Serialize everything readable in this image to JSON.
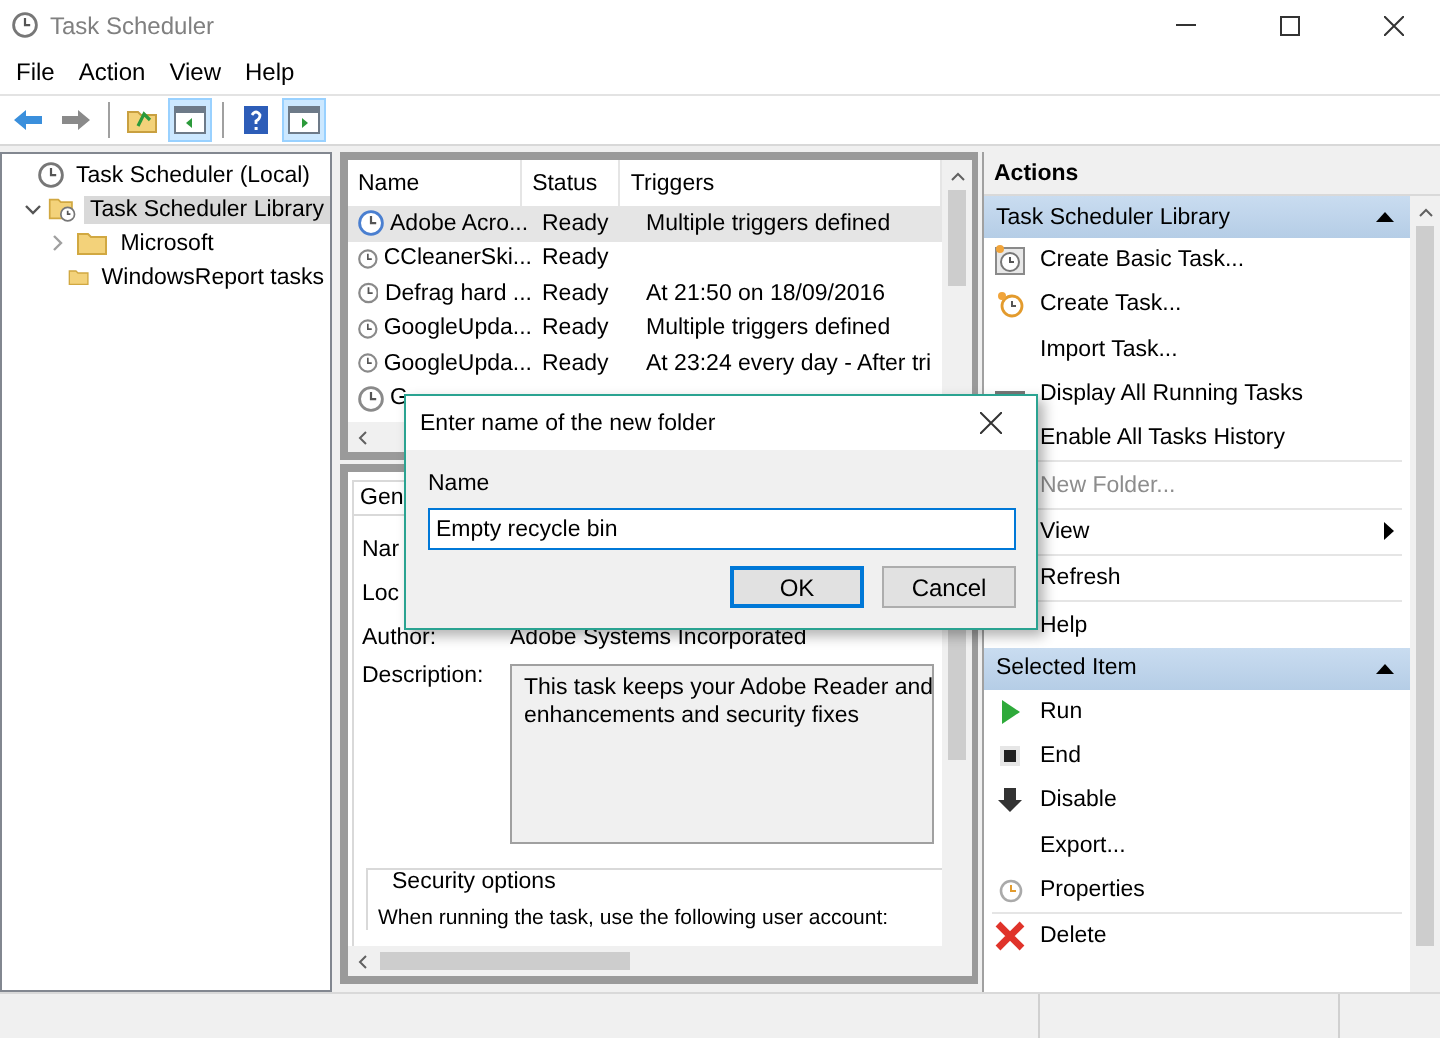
{
  "window": {
    "title": "Task Scheduler"
  },
  "menu": [
    "File",
    "Action",
    "View",
    "Help"
  ],
  "toolbar": [
    {
      "kind": "back",
      "pressed": false
    },
    {
      "kind": "forward",
      "pressed": false
    },
    {
      "kind": "up",
      "pressed": false
    },
    {
      "kind": "tree-toggle",
      "pressed": true
    },
    {
      "kind": "help",
      "pressed": false
    },
    {
      "kind": "action-toggle",
      "pressed": true
    }
  ],
  "tree": [
    {
      "label": "Task Scheduler (Local)",
      "selected": false,
      "expandable": false,
      "kind": "clock",
      "children": [
        {
          "label": "Task Scheduler Library",
          "selected": true,
          "expandable": true,
          "expanded": true,
          "kind": "library",
          "children": [
            {
              "label": "Microsoft",
              "selected": false,
              "expandable": true,
              "expanded": false,
              "kind": "folder"
            },
            {
              "label": "WindowsReport tasks",
              "selected": false,
              "expandable": false,
              "kind": "folder"
            }
          ]
        }
      ]
    }
  ],
  "task_list": {
    "columns": [
      "Name",
      "Status",
      "Triggers"
    ],
    "rows": [
      {
        "name": "Adobe Acro...",
        "status": "Ready",
        "triggers": "Multiple triggers defined",
        "selected": true
      },
      {
        "name": "CCleanerSki...",
        "status": "Ready",
        "selected": false
      },
      {
        "name": "Defrag hard ...",
        "status": "Ready",
        "triggers": "At 21:50 on 18/09/2016",
        "selected": false
      },
      {
        "name": "GoogleUpda...",
        "status": "Ready",
        "triggers": "Multiple triggers defined",
        "selected": false
      },
      {
        "name": "GoogleUpda...",
        "status": "Ready",
        "triggers": "At 23:24 every day - After tri",
        "selected": false
      },
      {
        "name": "G",
        "selected": false
      }
    ]
  },
  "details": {
    "tab": "Gen",
    "fields": [
      {
        "label": "Nar"
      },
      {
        "label": "Loc"
      },
      {
        "label": "Author:",
        "value": "Adobe Systems Incorporated"
      }
    ],
    "description_label": "Description:",
    "description": [
      "This task keeps your Adobe Reader and",
      "enhancements and security fixes"
    ],
    "security_title": "Security options",
    "security_text": "When running the task, use the following user account:"
  },
  "actions": {
    "title": "Actions",
    "sections": [
      {
        "title": "Task Scheduler Library",
        "expanded": true,
        "groups": [
          [
            {
              "label": "Create Basic Task...",
              "kind": "wizard",
              "disabled": false,
              "submenu": false
            },
            {
              "label": "Create Task...",
              "kind": "new-task",
              "disabled": false,
              "submenu": false
            },
            {
              "label": "Import Task...",
              "kind": "plain",
              "disabled": false,
              "submenu": false
            },
            {
              "label": "Display All Running Tasks",
              "kind": "list",
              "disabled": false,
              "submenu": false
            },
            {
              "label": "Enable All Tasks History",
              "kind": "plain",
              "disabled": false,
              "submenu": false
            }
          ],
          [
            {
              "label": "New Folder...",
              "kind": "plain",
              "disabled": true,
              "submenu": false
            }
          ],
          [
            {
              "label": "View",
              "kind": "plain",
              "disabled": false,
              "submenu": true
            }
          ],
          [
            {
              "label": "Refresh",
              "kind": "plain",
              "disabled": false,
              "submenu": false
            }
          ],
          [
            {
              "label": "Help",
              "kind": "help",
              "disabled": false,
              "submenu": false
            }
          ]
        ]
      },
      {
        "title": "Selected Item",
        "expanded": true,
        "groups": [
          [
            {
              "label": "Run",
              "kind": "run",
              "disabled": false,
              "submenu": false
            },
            {
              "label": "End",
              "kind": "end",
              "disabled": false,
              "submenu": false
            },
            {
              "label": "Disable",
              "kind": "disable",
              "disabled": false,
              "submenu": false
            },
            {
              "label": "Export...",
              "kind": "plain",
              "disabled": false,
              "submenu": false
            },
            {
              "label": "Properties",
              "kind": "properties",
              "disabled": false,
              "submenu": false
            }
          ],
          [
            {
              "label": "Delete",
              "kind": "delete",
              "disabled": false,
              "submenu": false
            }
          ]
        ]
      }
    ]
  },
  "dialog": {
    "title": "Enter name of the new folder",
    "field_label": "Name",
    "value": "Empty recycle bin",
    "buttons": [
      {
        "label": "OK",
        "default": true
      },
      {
        "label": "Cancel",
        "default": false
      }
    ]
  }
}
